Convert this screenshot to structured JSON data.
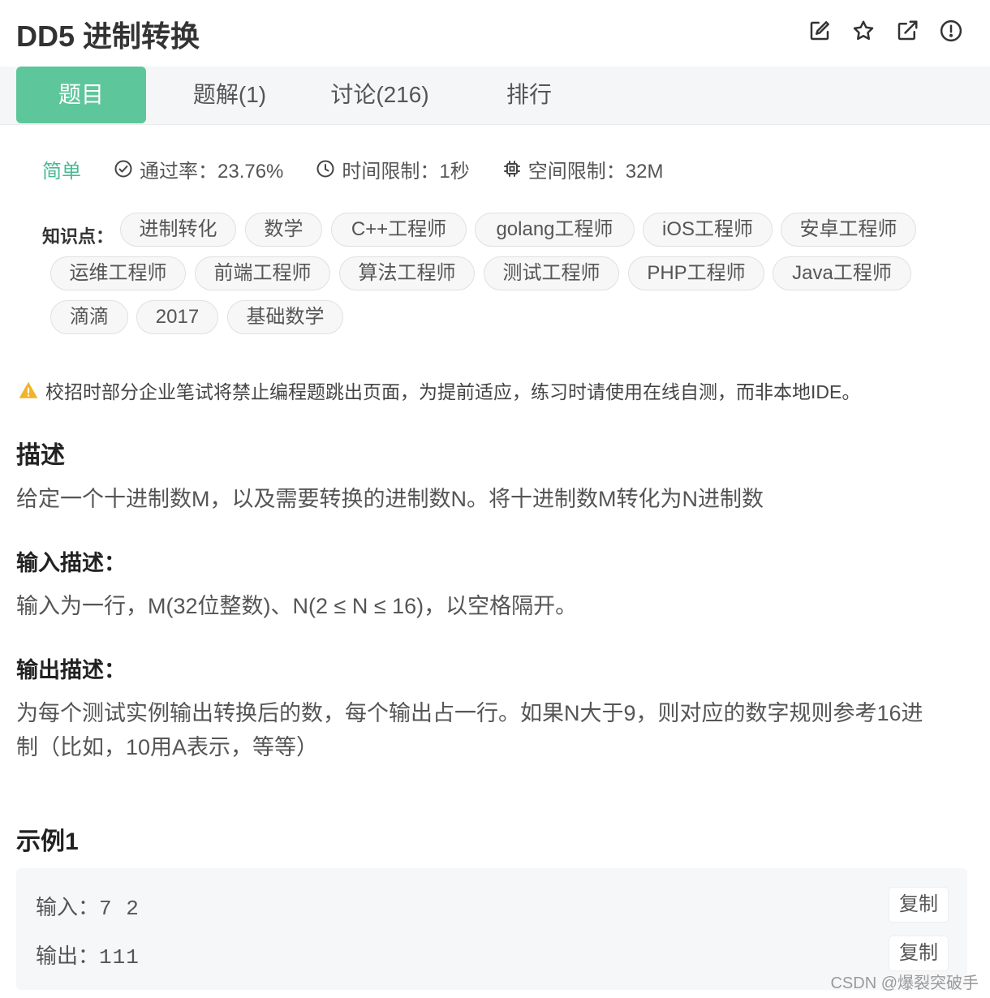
{
  "problem": {
    "title": "DD5  进制转换"
  },
  "header_icons": [
    "edit-icon",
    "star-icon",
    "share-icon",
    "report-icon"
  ],
  "tabs": [
    {
      "label": "题目",
      "active": true
    },
    {
      "label": "题解(1)",
      "active": false
    },
    {
      "label": "讨论(216)",
      "active": false
    },
    {
      "label": "排行",
      "active": false
    }
  ],
  "meta": {
    "difficulty": "简单",
    "pass_rate": "通过率：23.76%",
    "time_limit": "时间限制：1秒",
    "memory_limit": "空间限制：32M"
  },
  "knowledge": {
    "label": "知识点：",
    "tags": [
      "进制转化",
      "数学",
      "C++工程师",
      "golang工程师",
      "iOS工程师",
      "安卓工程师",
      "运维工程师",
      "前端工程师",
      "算法工程师",
      "测试工程师",
      "PHP工程师",
      "Java工程师",
      "滴滴",
      "2017",
      "基础数学"
    ]
  },
  "warning": "校招时部分企业笔试将禁止编程题跳出页面，为提前适应，练习时请使用在线自测，而非本地IDE。",
  "description": {
    "heading": "描述",
    "text": "给定一个十进制数M，以及需要转换的进制数N。将十进制数M转化为N进制数"
  },
  "input_desc": {
    "heading": "输入描述：",
    "text": "输入为一行，M(32位整数)、N(2 ≤ N ≤ 16)，以空格隔开。"
  },
  "output_desc": {
    "heading": "输出描述：",
    "line1": "为每个测试实例输出转换后的数，每个输出占一行。如果N大于9，则对应的数字规则参考16进",
    "line2": "制（比如，10用A表示，等等）"
  },
  "example": {
    "heading": "示例1",
    "input_label": "输入：",
    "input_value": "7 2",
    "output_label": "输出：",
    "output_value": "111",
    "copy_label": "复制"
  },
  "watermark": "CSDN @爆裂突破手",
  "colors": {
    "accent": "#5ec69b",
    "difficulty": "#4cb893"
  }
}
